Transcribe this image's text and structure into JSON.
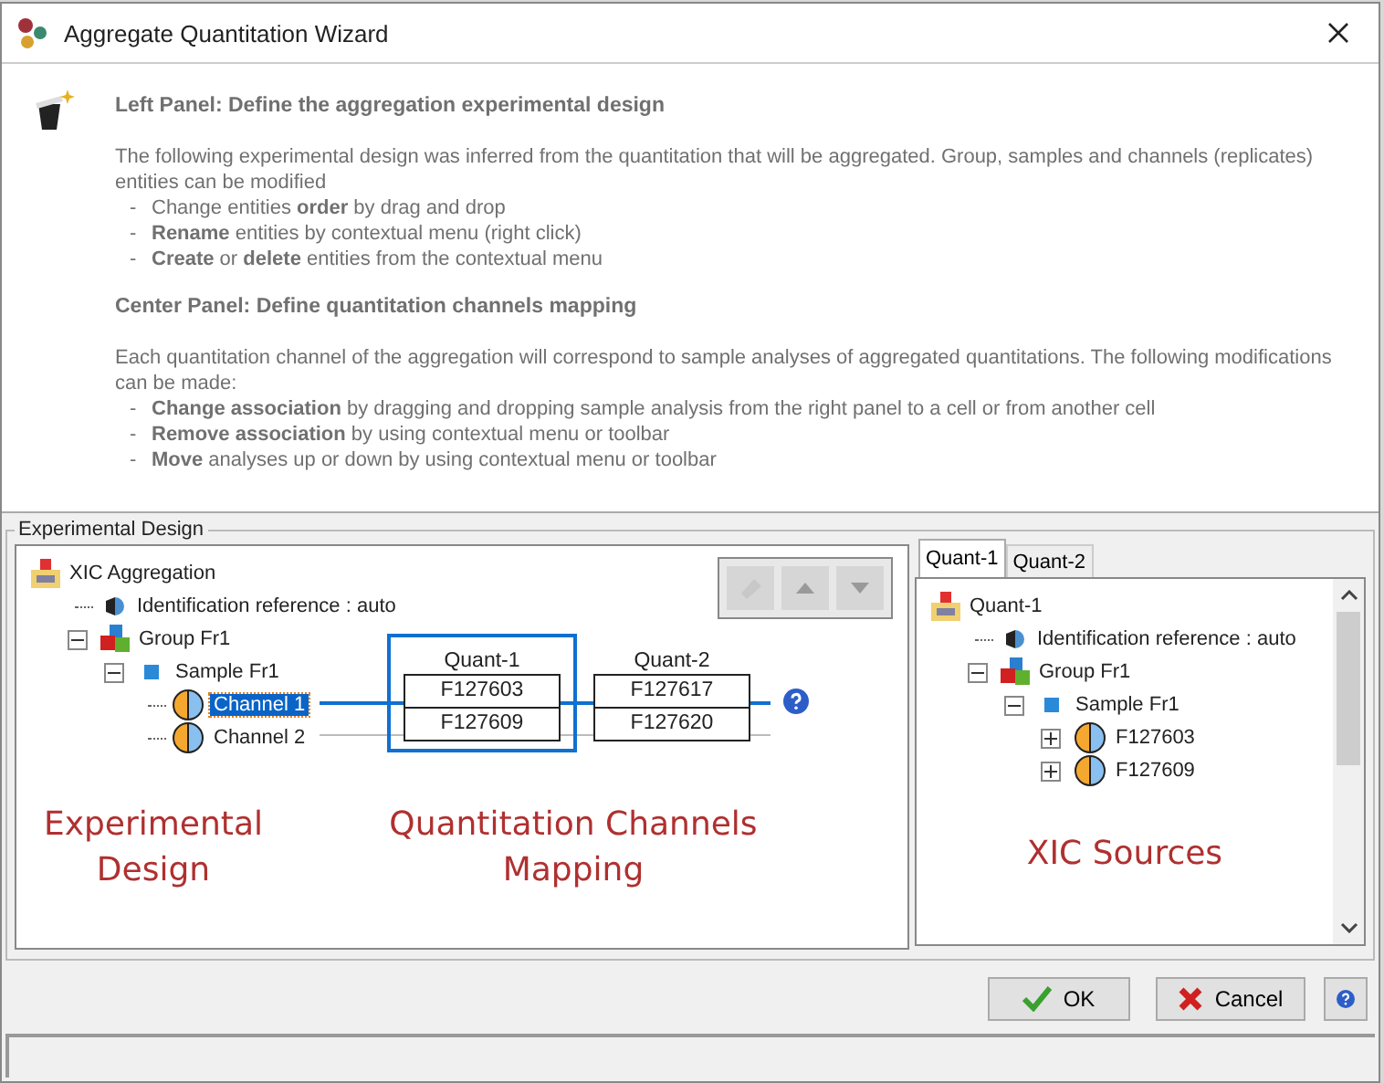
{
  "window": {
    "title": "Aggregate Quantitation Wizard"
  },
  "intro": [
    {
      "heading": "Left Panel: Define the aggregation experimental design",
      "paragraph": "The following experimental design was inferred from the quantitation that will be aggregated. Group, samples and channels (replicates) entities can be modified",
      "bullets": [
        {
          "marker": "-",
          "text": "Change entities **order** by drag and drop"
        },
        {
          "marker": "-",
          "text": "**Rename** entities by contextual menu (right click)"
        },
        {
          "marker": "-",
          "text": "**Create** or **delete** entities from the contextual menu"
        }
      ]
    },
    {
      "heading": "Center Panel: Define quantitation channels mapping",
      "paragraph": "Each quantitation channel of the aggregation will correspond to sample analyses of aggregated quantitations. The following modifications can be made:",
      "bullets": [
        {
          "marker": "-",
          "text": "**Change association** by dragging and dropping sample analysis from the right panel to a cell or from another cell"
        },
        {
          "marker": "-",
          "text": "**Remove association** by using contextual menu or toolbar"
        },
        {
          "marker": "-",
          "text": "**Move** analyses up or down by using contextual menu or toolbar"
        }
      ]
    }
  ],
  "design": {
    "legend": "Experimental Design",
    "tree": [
      {
        "kind": "xic",
        "label": "XIC Aggregation",
        "children": [
          {
            "kind": "ident",
            "label": "Identification reference : auto"
          },
          {
            "kind": "group",
            "label": "Group Fr1",
            "expanded": true,
            "children": [
              {
                "kind": "sample",
                "label": "Sample Fr1",
                "expanded": true,
                "children": [
                  {
                    "kind": "channel",
                    "label": "Channel 1",
                    "selected": true
                  },
                  {
                    "kind": "channel",
                    "label": "Channel 2",
                    "selected": false
                  }
                ]
              }
            ]
          }
        ]
      }
    ],
    "toolbar": [
      {
        "kind": "edit",
        "disabled": true
      },
      {
        "kind": "up",
        "disabled": true
      },
      {
        "kind": "down",
        "disabled": true
      }
    ],
    "mapping": {
      "columns": [
        {
          "name": "Quant-1",
          "selected": true,
          "cells": [
            "F127603",
            "F127609"
          ]
        },
        {
          "name": "Quant-2",
          "selected": false,
          "cells": [
            "F127617",
            "F127620"
          ]
        }
      ],
      "rows": [
        {
          "highlighted": true,
          "help": true
        },
        {
          "highlighted": false
        }
      ]
    },
    "labels": [
      "Experimental Design",
      "Quantitation Channels Mapping"
    ]
  },
  "sources": {
    "tabs": [
      {
        "label": "Quant-1",
        "selected": true
      },
      {
        "label": "Quant-2",
        "selected": false
      }
    ],
    "tree": [
      {
        "kind": "xic",
        "label": "Quant-1",
        "children": [
          {
            "kind": "ident",
            "label": "Identification reference : auto"
          },
          {
            "kind": "group",
            "label": "Group Fr1",
            "expanded": true,
            "children": [
              {
                "kind": "sample",
                "label": "Sample Fr1",
                "expanded": true,
                "children": [
                  {
                    "kind": "channel",
                    "label": "F127603",
                    "expanded": false
                  },
                  {
                    "kind": "channel",
                    "label": "F127609",
                    "expanded": false
                  }
                ]
              }
            ]
          }
        ]
      }
    ],
    "label": "XIC Sources"
  },
  "buttons": [
    {
      "kind": "ok",
      "label": "OK"
    },
    {
      "kind": "cancel",
      "label": "Cancel"
    },
    {
      "kind": "help"
    }
  ]
}
